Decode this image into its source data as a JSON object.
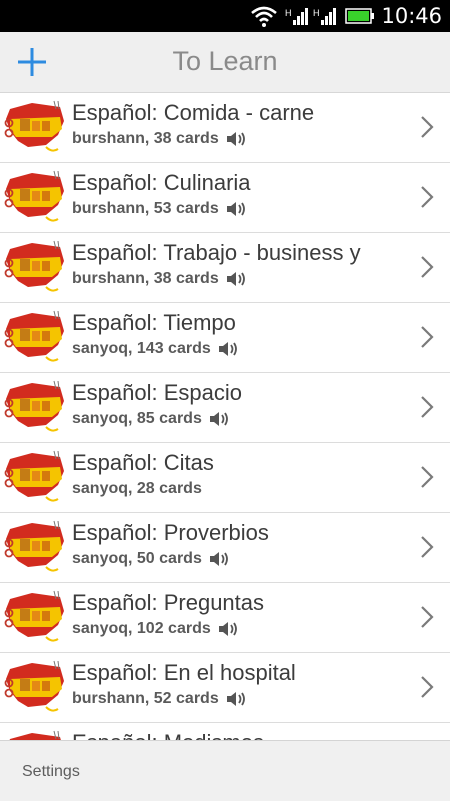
{
  "status": {
    "time": "10:46",
    "signal_labels": [
      "H",
      "H"
    ]
  },
  "actionbar": {
    "title": "To Learn",
    "add_icon": "plus-icon",
    "accent": "#2d8be0"
  },
  "decks": [
    {
      "title": "Español: Comida - carne",
      "meta": "burshann, 38 cards",
      "audio": true
    },
    {
      "title": "Español: Culinaria",
      "meta": "burshann, 53 cards",
      "audio": true
    },
    {
      "title": "Español: Trabajo - business y",
      "meta": "burshann, 38 cards",
      "audio": true
    },
    {
      "title": "Español: Tiempo",
      "meta": "sanyoq, 143 cards",
      "audio": true
    },
    {
      "title": "Español: Espacio",
      "meta": "sanyoq, 85 cards",
      "audio": true
    },
    {
      "title": "Español: Citas",
      "meta": "sanyoq, 28 cards",
      "audio": false
    },
    {
      "title": "Español: Proverbios",
      "meta": "sanyoq, 50 cards",
      "audio": true
    },
    {
      "title": "Español: Preguntas",
      "meta": "sanyoq, 102 cards",
      "audio": true
    },
    {
      "title": "Español: En el hospital",
      "meta": "burshann, 52 cards",
      "audio": true
    },
    {
      "title": "Español: Modismos",
      "meta": "",
      "audio": false
    }
  ],
  "footer": {
    "settings_label": "Settings"
  }
}
